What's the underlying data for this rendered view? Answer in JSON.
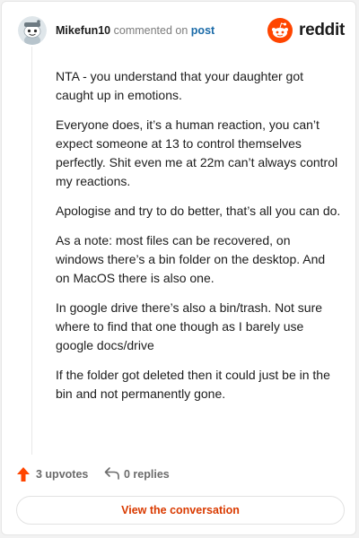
{
  "header": {
    "username": "Mikefun10",
    "action_text": "commented on",
    "post_link": "post",
    "brand_name": "reddit",
    "brand_color": "#ff4500"
  },
  "comment": {
    "paragraphs": [
      "NTA - you understand that your daughter got caught up in emotions.",
      "Everyone does, it’s a human reaction, you can’t expect someone at 13 to control themselves perfectly. Shit even me at 22m can’t always control my reactions.",
      "Apologise and try to do better, that’s all you can do.",
      "As a note: most files can be recovered, on windows there’s a bin folder on the desktop. And on MacOS there is also one.",
      "In google drive there’s also a bin/trash. Not sure where to find that one though as I barely use google docs/drive",
      "If the folder got deleted then it could just be in the bin and not permanently gone."
    ]
  },
  "actions": {
    "upvotes_label": "3 upvotes",
    "replies_label": "0 replies",
    "upvote_icon": "upvote-arrow-icon",
    "reply_icon": "reply-arrow-icon",
    "upvote_color": "#ff4500"
  },
  "cta": {
    "label": "View the conversation",
    "color": "#d93a00"
  }
}
